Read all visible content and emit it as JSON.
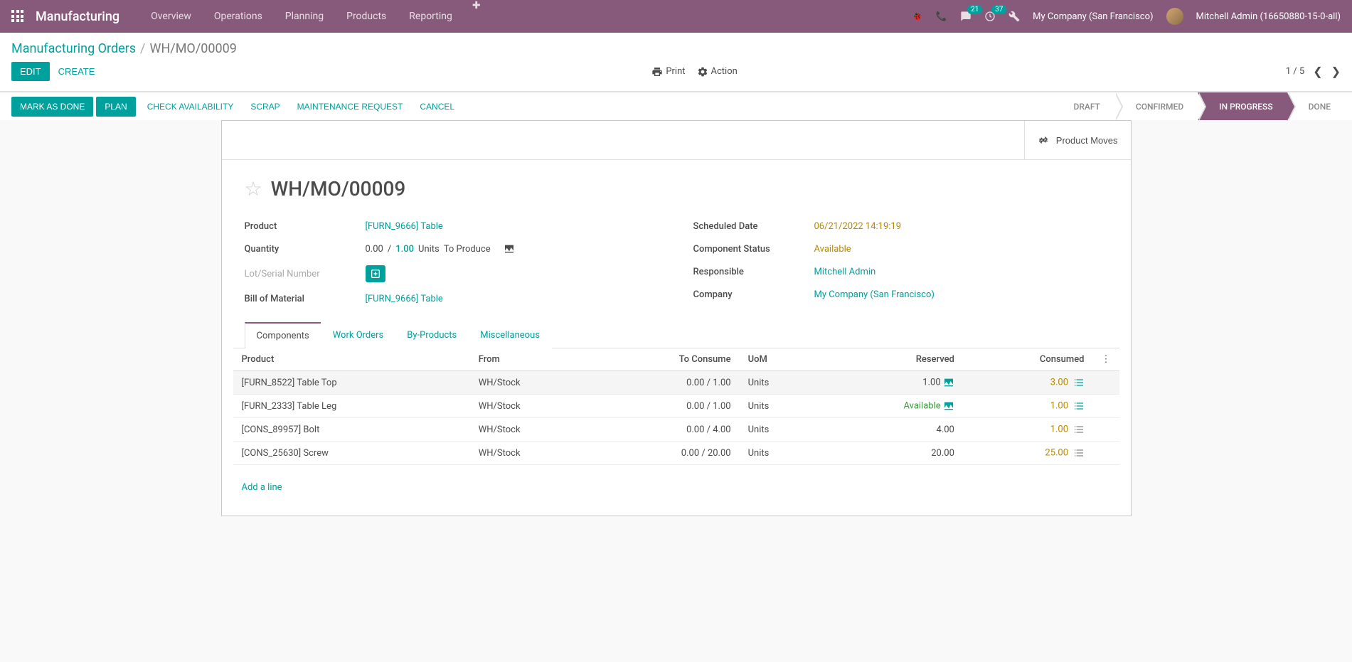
{
  "topbar": {
    "brand": "Manufacturing",
    "menu": [
      "Overview",
      "Operations",
      "Planning",
      "Products",
      "Reporting"
    ],
    "chat_badge": "21",
    "activity_badge": "37",
    "company": "My Company (San Francisco)",
    "user": "Mitchell Admin (16650880-15-0-all)"
  },
  "breadcrumb": {
    "parent": "Manufacturing Orders",
    "current": "WH/MO/00009"
  },
  "cp": {
    "edit": "Edit",
    "create": "Create",
    "print": "Print",
    "action": "Action",
    "pager": "1 / 5"
  },
  "statusbar": {
    "buttons": {
      "mark_done": "Mark as Done",
      "plan": "Plan",
      "check_avail": "Check availability",
      "scrap": "Scrap",
      "maint": "Maintenance Request",
      "cancel": "Cancel"
    },
    "states": [
      "Draft",
      "Confirmed",
      "In Progress",
      "Done"
    ],
    "active_index": 2
  },
  "stat_button": "Product Moves",
  "record": {
    "name": "WH/MO/00009",
    "product": "[FURN_9666] Table",
    "qty_done": "0.00",
    "qty_sep": "/",
    "qty_todo": "1.00",
    "uom": "Units",
    "to_produce": "To Produce",
    "lot_label": "Lot/Serial Number",
    "bom": "[FURN_9666] Table",
    "scheduled": "06/21/2022 14:19:19",
    "component_status": "Available",
    "responsible": "Mitchell Admin",
    "company": "My Company (San Francisco)",
    "labels": {
      "product": "Product",
      "quantity": "Quantity",
      "bom": "Bill of Material",
      "scheduled": "Scheduled Date",
      "comp_status": "Component Status",
      "responsible": "Responsible",
      "company": "Company"
    }
  },
  "tabs": [
    "Components",
    "Work Orders",
    "By-Products",
    "Miscellaneous"
  ],
  "components": {
    "headers": {
      "product": "Product",
      "from": "From",
      "to_consume": "To Consume",
      "uom": "UoM",
      "reserved": "Reserved",
      "consumed": "Consumed"
    },
    "rows": [
      {
        "product": "[FURN_8522] Table Top",
        "from": "WH/Stock",
        "to_consume": "0.00 / 1.00",
        "uom": "Units",
        "reserved": "1.00",
        "reserved_type": "num",
        "consumed": "3.00",
        "icon": "teal",
        "hover": true
      },
      {
        "product": "[FURN_2333] Table Leg",
        "from": "WH/Stock",
        "to_consume": "0.00 / 1.00",
        "uom": "Units",
        "reserved": "Available",
        "reserved_type": "avail",
        "consumed": "1.00",
        "icon": "teal"
      },
      {
        "product": "[CONS_89957] Bolt",
        "from": "WH/Stock",
        "to_consume": "0.00 / 4.00",
        "uom": "Units",
        "reserved": "4.00",
        "reserved_type": "num",
        "consumed": "1.00",
        "icon": "gray"
      },
      {
        "product": "[CONS_25630] Screw",
        "from": "WH/Stock",
        "to_consume": "0.00 / 20.00",
        "uom": "Units",
        "reserved": "20.00",
        "reserved_type": "num",
        "consumed": "25.00",
        "icon": "gray"
      }
    ],
    "add_line": "Add a line"
  }
}
